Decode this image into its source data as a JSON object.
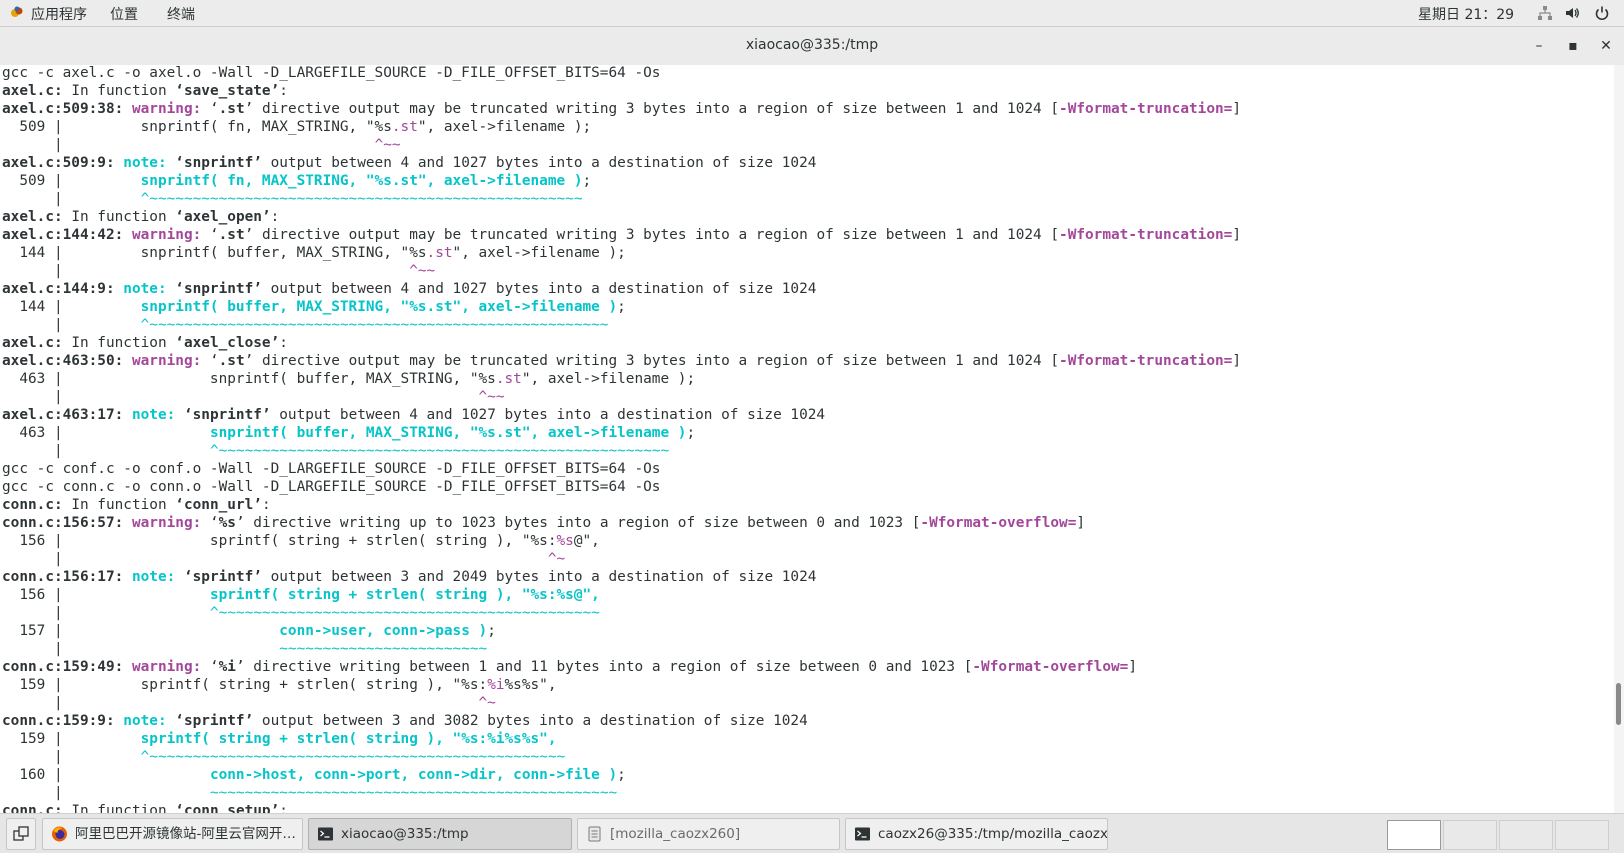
{
  "top_panel": {
    "menu": [
      "应用程序",
      "位置",
      "终端"
    ],
    "clock": "星期日 21：29"
  },
  "window": {
    "title": "xiaocao@335:/tmp",
    "minimize": "–",
    "maximize": "▪",
    "close": "✕"
  },
  "terminal": {
    "lines": [
      [
        [
          "n",
          "gcc -c axel.c -o axel.o -Wall -D_LARGEFILE_SOURCE -D_FILE_OFFSET_BITS=64 -Os"
        ]
      ],
      [
        [
          "b",
          "axel.c:"
        ],
        [
          "n",
          " In function "
        ],
        [
          "b",
          "‘save_state’"
        ],
        [
          "n",
          ":"
        ]
      ],
      [
        [
          "b",
          "axel.c:509:38: "
        ],
        [
          "w",
          "warning: "
        ],
        [
          "n",
          "‘"
        ],
        [
          "b",
          ".st"
        ],
        [
          "n",
          "’ directive output may be truncated writing 3 bytes into a region of size between 1 and 1024 ["
        ],
        [
          "f",
          "-Wformat-truncation="
        ],
        [
          "n",
          "]"
        ]
      ],
      [
        [
          "n",
          "  509 |         snprintf( fn, MAX_STRING, \"%s"
        ],
        [
          "h",
          ".st"
        ],
        [
          "n",
          "\", axel->filename );"
        ]
      ],
      [
        [
          "n",
          "      |                                    "
        ],
        [
          "cm",
          "^~~"
        ]
      ],
      [
        [
          "b",
          "axel.c:509:9: "
        ],
        [
          "c",
          "note: "
        ],
        [
          "b",
          "‘snprintf’"
        ],
        [
          "n",
          " output between 4 and 1027 bytes into a destination of size 1024"
        ]
      ],
      [
        [
          "n",
          "  509 |         "
        ],
        [
          "c",
          "snprintf( fn, MAX_STRING, \"%s.st\", axel->filename )"
        ],
        [
          "n",
          ";"
        ]
      ],
      [
        [
          "n",
          "      |         "
        ],
        [
          "cc",
          "^~~~~~~~~~~~~~~~~~~~~~~~~~~~~~~~~~~~~~~~~~~~~~~~~~~"
        ]
      ],
      [
        [
          "b",
          "axel.c:"
        ],
        [
          "n",
          " In function "
        ],
        [
          "b",
          "‘axel_open’"
        ],
        [
          "n",
          ":"
        ]
      ],
      [
        [
          "b",
          "axel.c:144:42: "
        ],
        [
          "w",
          "warning: "
        ],
        [
          "n",
          "‘"
        ],
        [
          "b",
          ".st"
        ],
        [
          "n",
          "’ directive output may be truncated writing 3 bytes into a region of size between 1 and 1024 ["
        ],
        [
          "f",
          "-Wformat-truncation="
        ],
        [
          "n",
          "]"
        ]
      ],
      [
        [
          "n",
          "  144 |         snprintf( buffer, MAX_STRING, \"%s"
        ],
        [
          "h",
          ".st"
        ],
        [
          "n",
          "\", axel->filename );"
        ]
      ],
      [
        [
          "n",
          "      |                                        "
        ],
        [
          "cm",
          "^~~"
        ]
      ],
      [
        [
          "b",
          "axel.c:144:9: "
        ],
        [
          "c",
          "note: "
        ],
        [
          "b",
          "‘snprintf’"
        ],
        [
          "n",
          " output between 4 and 1027 bytes into a destination of size 1024"
        ]
      ],
      [
        [
          "n",
          "  144 |         "
        ],
        [
          "c",
          "snprintf( buffer, MAX_STRING, \"%s.st\", axel->filename )"
        ],
        [
          "n",
          ";"
        ]
      ],
      [
        [
          "n",
          "      |         "
        ],
        [
          "cc",
          "^~~~~~~~~~~~~~~~~~~~~~~~~~~~~~~~~~~~~~~~~~~~~~~~~~~~~~"
        ]
      ],
      [
        [
          "b",
          "axel.c:"
        ],
        [
          "n",
          " In function "
        ],
        [
          "b",
          "‘axel_close’"
        ],
        [
          "n",
          ":"
        ]
      ],
      [
        [
          "b",
          "axel.c:463:50: "
        ],
        [
          "w",
          "warning: "
        ],
        [
          "n",
          "‘"
        ],
        [
          "b",
          ".st"
        ],
        [
          "n",
          "’ directive output may be truncated writing 3 bytes into a region of size between 1 and 1024 ["
        ],
        [
          "f",
          "-Wformat-truncation="
        ],
        [
          "n",
          "]"
        ]
      ],
      [
        [
          "n",
          "  463 |                 snprintf( buffer, MAX_STRING, \"%s"
        ],
        [
          "h",
          ".st"
        ],
        [
          "n",
          "\", axel->filename );"
        ]
      ],
      [
        [
          "n",
          "      |                                                "
        ],
        [
          "cm",
          "^~~"
        ]
      ],
      [
        [
          "b",
          "axel.c:463:17: "
        ],
        [
          "c",
          "note: "
        ],
        [
          "b",
          "‘snprintf’"
        ],
        [
          "n",
          " output between 4 and 1027 bytes into a destination of size 1024"
        ]
      ],
      [
        [
          "n",
          "  463 |                 "
        ],
        [
          "c",
          "snprintf( buffer, MAX_STRING, \"%s.st\", axel->filename )"
        ],
        [
          "n",
          ";"
        ]
      ],
      [
        [
          "n",
          "      |                 "
        ],
        [
          "cc",
          "^~~~~~~~~~~~~~~~~~~~~~~~~~~~~~~~~~~~~~~~~~~~~~~~~~~~~"
        ]
      ],
      [
        [
          "n",
          "gcc -c conf.c -o conf.o -Wall -D_LARGEFILE_SOURCE -D_FILE_OFFSET_BITS=64 -Os"
        ]
      ],
      [
        [
          "n",
          "gcc -c conn.c -o conn.o -Wall -D_LARGEFILE_SOURCE -D_FILE_OFFSET_BITS=64 -Os"
        ]
      ],
      [
        [
          "b",
          "conn.c:"
        ],
        [
          "n",
          " In function "
        ],
        [
          "b",
          "‘conn_url’"
        ],
        [
          "n",
          ":"
        ]
      ],
      [
        [
          "b",
          "conn.c:156:57: "
        ],
        [
          "w",
          "warning: "
        ],
        [
          "n",
          "‘"
        ],
        [
          "b",
          "%s"
        ],
        [
          "n",
          "’ directive writing up to 1023 bytes into a region of size between 0 and 1023 ["
        ],
        [
          "f",
          "-Wformat-overflow="
        ],
        [
          "n",
          "]"
        ]
      ],
      [
        [
          "n",
          "  156 |                 sprintf( string + strlen( string ), \"%s:"
        ],
        [
          "h",
          "%s"
        ],
        [
          "n",
          "@\","
        ]
      ],
      [
        [
          "n",
          "      |                                                        "
        ],
        [
          "cm",
          "^~"
        ]
      ],
      [
        [
          "b",
          "conn.c:156:17: "
        ],
        [
          "c",
          "note: "
        ],
        [
          "b",
          "‘sprintf’"
        ],
        [
          "n",
          " output between 3 and 2049 bytes into a destination of size 1024"
        ]
      ],
      [
        [
          "n",
          "  156 |                 "
        ],
        [
          "c",
          "sprintf( string + strlen( string ), \"%s:%s@\","
        ]
      ],
      [
        [
          "n",
          "      |                 "
        ],
        [
          "cc",
          "^~~~~~~~~~~~~~~~~~~~~~~~~~~~~~~~~~~~~~~~~~~~~"
        ]
      ],
      [
        [
          "n",
          "  157 |                         "
        ],
        [
          "c",
          "conn->user, conn->pass )"
        ],
        [
          "n",
          ";"
        ]
      ],
      [
        [
          "n",
          "      |                         "
        ],
        [
          "cc",
          "~~~~~~~~~~~~~~~~~~~~~~~~"
        ]
      ],
      [
        [
          "b",
          "conn.c:159:49: "
        ],
        [
          "w",
          "warning: "
        ],
        [
          "n",
          "‘"
        ],
        [
          "b",
          "%i"
        ],
        [
          "n",
          "’ directive writing between 1 and 11 bytes into a region of size between 0 and 1023 ["
        ],
        [
          "f",
          "-Wformat-overflow="
        ],
        [
          "n",
          "]"
        ]
      ],
      [
        [
          "n",
          "  159 |         sprintf( string + strlen( string ), \"%s:"
        ],
        [
          "h",
          "%i"
        ],
        [
          "n",
          "%s%s\","
        ]
      ],
      [
        [
          "n",
          "      |                                                "
        ],
        [
          "cm",
          "^~"
        ]
      ],
      [
        [
          "b",
          "conn.c:159:9: "
        ],
        [
          "c",
          "note: "
        ],
        [
          "b",
          "‘sprintf’"
        ],
        [
          "n",
          " output between 3 and 3082 bytes into a destination of size 1024"
        ]
      ],
      [
        [
          "n",
          "  159 |         "
        ],
        [
          "c",
          "sprintf( string + strlen( string ), \"%s:%i%s%s\","
        ]
      ],
      [
        [
          "n",
          "      |         "
        ],
        [
          "cc",
          "^~~~~~~~~~~~~~~~~~~~~~~~~~~~~~~~~~~~~~~~~~~~~~~~~"
        ]
      ],
      [
        [
          "n",
          "  160 |                 "
        ],
        [
          "c",
          "conn->host, conn->port, conn->dir, conn->file )"
        ],
        [
          "n",
          ";"
        ]
      ],
      [
        [
          "n",
          "      |                 "
        ],
        [
          "cc",
          "~~~~~~~~~~~~~~~~~~~~~~~~~~~~~~~~~~~~~~~~~~~~~~~"
        ]
      ],
      [
        [
          "b",
          "conn.c:"
        ],
        [
          "n",
          " In function "
        ],
        [
          "b",
          "‘conn_setup’"
        ],
        [
          "n",
          ":"
        ]
      ]
    ]
  },
  "taskbar": {
    "items": [
      {
        "label": "阿里巴巴开源镜像站-阿里云官网开…",
        "icon": "firefox-icon"
      },
      {
        "label": "xiaocao@335:/tmp",
        "icon": "terminal-icon"
      },
      {
        "label": "[mozilla_caozx260]",
        "icon": "file-manager-icon"
      },
      {
        "label": "caozx26@335:/tmp/mozilla_caozx…",
        "icon": "terminal-icon"
      }
    ],
    "workspaces": 4
  }
}
